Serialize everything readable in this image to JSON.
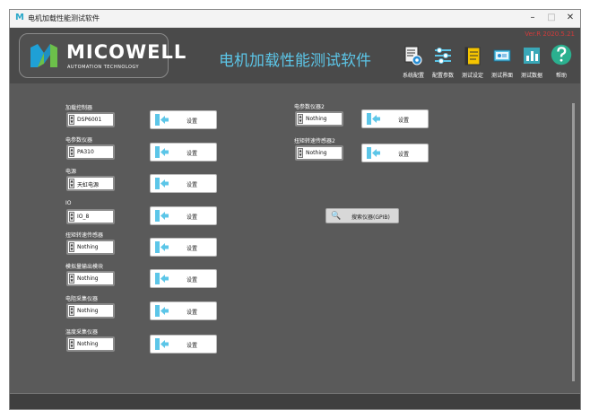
{
  "window": {
    "title": "电机加载性能测试软件",
    "app_icon": "M"
  },
  "header": {
    "logo_text": "MICOWELL",
    "logo_sub": "AUTOMATION TECHNOLOGY",
    "app_title": "电机加载性能测试软件",
    "version": "Ver.R 2020.5.21"
  },
  "toolbar": {
    "items": [
      {
        "label": "系统配置",
        "icon": "system-config-icon"
      },
      {
        "label": "配置参数",
        "icon": "sliders-icon"
      },
      {
        "label": "测试设定",
        "icon": "notepad-icon"
      },
      {
        "label": "测试界面",
        "icon": "monitor-icon"
      },
      {
        "label": "测试数据",
        "icon": "chart-icon"
      },
      {
        "label": "帮助",
        "icon": "help-icon"
      }
    ]
  },
  "main": {
    "left": [
      {
        "label": "加载控制器",
        "value": "DSP6001",
        "button": "设置"
      },
      {
        "label": "电参数仪器",
        "value": "PA310",
        "button": "设置"
      },
      {
        "label": "电源",
        "value": "天虹电源",
        "button": "设置"
      },
      {
        "label": "IO",
        "value": "IO_8",
        "button": "设置"
      },
      {
        "label": "扭矩转速传感器",
        "value": "Nothing",
        "button": "设置"
      },
      {
        "label": "模拟量输出模块",
        "value": "Nothing",
        "button": "设置"
      },
      {
        "label": "电阻采集仪器",
        "value": "Nothing",
        "button": "设置"
      },
      {
        "label": "温度采集仪器",
        "value": "Nothing",
        "button": "设置"
      }
    ],
    "right": [
      {
        "label": "电参数仪器2",
        "value": "Nothing",
        "button": "设置"
      },
      {
        "label": "扭矩转速传感器2",
        "value": "Nothing",
        "button": "设置"
      }
    ],
    "scan_button": "搜索仪器(GPIB)"
  },
  "colors": {
    "accent": "#5cc6e8",
    "background": "#5a5a5a",
    "header": "#4a4a4a",
    "version": "#d23a3a"
  }
}
